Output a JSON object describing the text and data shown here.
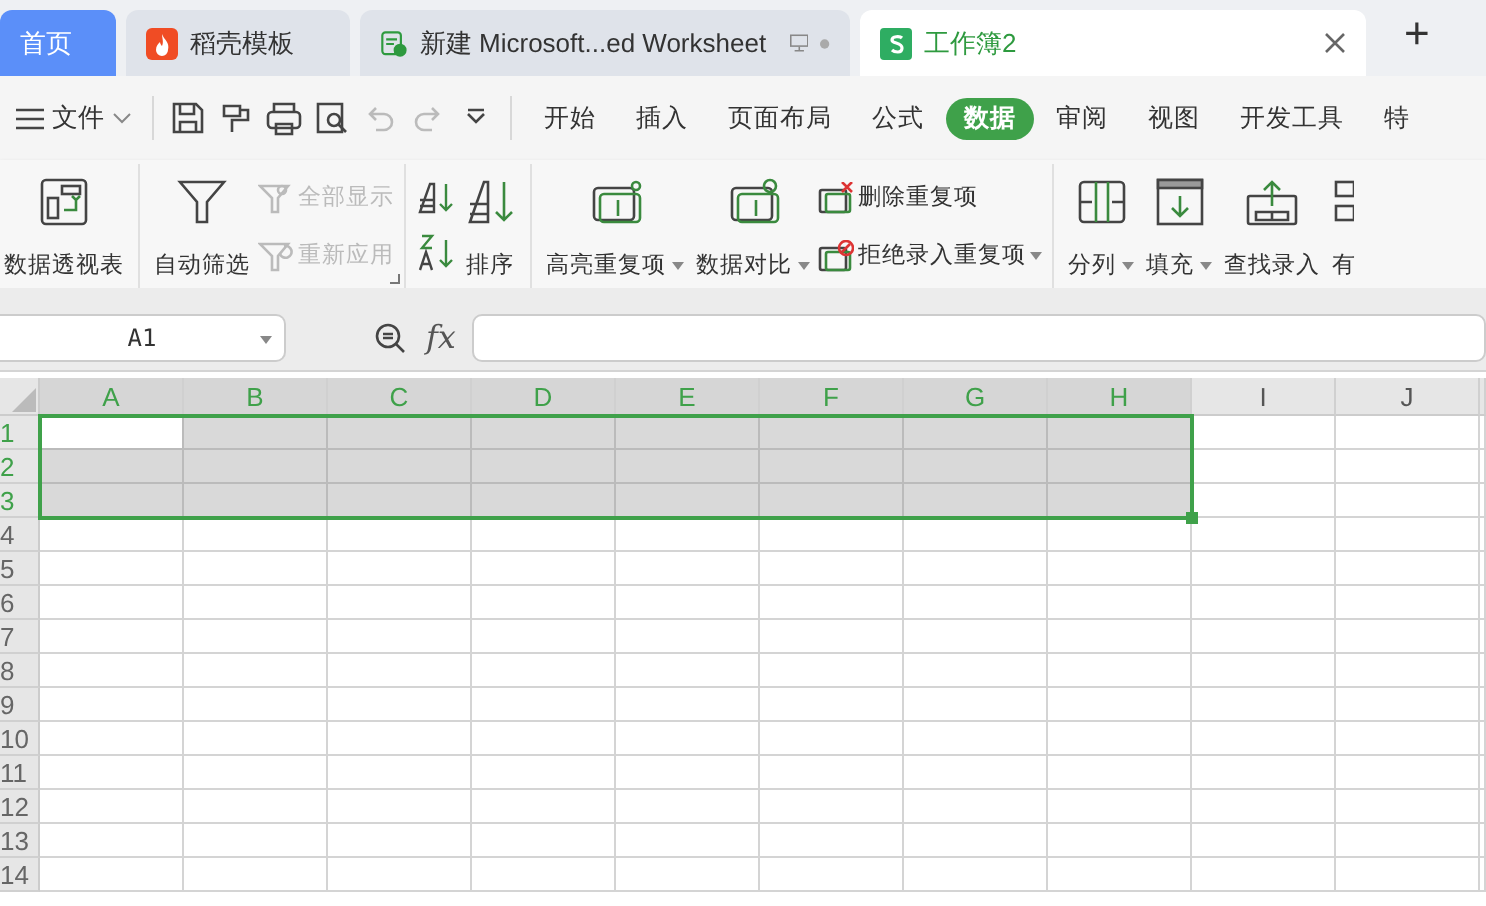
{
  "tabs": [
    {
      "kind": "home",
      "label": "首页",
      "selected": false
    },
    {
      "kind": "docer",
      "label": "稻壳模板",
      "selected": false
    },
    {
      "kind": "doc",
      "label": "新建 Microsoft...ed Worksheet",
      "selected": false
    },
    {
      "kind": "sheet",
      "label": "工作簿2",
      "selected": true
    }
  ],
  "new_tab": "+",
  "file_menu": "文件",
  "quick_tools": [
    {
      "kind": "save",
      "disabled": false
    },
    {
      "kind": "painter",
      "disabled": false
    },
    {
      "kind": "print",
      "disabled": false
    },
    {
      "kind": "preview",
      "disabled": false
    },
    {
      "kind": "undo",
      "disabled": true
    },
    {
      "kind": "redo",
      "disabled": true
    },
    {
      "kind": "more",
      "disabled": false
    }
  ],
  "ribbon_tabs": [
    {
      "label": "开始",
      "selected": false
    },
    {
      "label": "插入",
      "selected": false
    },
    {
      "label": "页面布局",
      "selected": false
    },
    {
      "label": "公式",
      "selected": false
    },
    {
      "label": "数据",
      "selected": true
    },
    {
      "label": "审阅",
      "selected": false
    },
    {
      "label": "视图",
      "selected": false
    },
    {
      "label": "开发工具",
      "selected": false
    },
    {
      "label": "特",
      "selected": false
    }
  ],
  "ribbon_groups": [
    {
      "items": [
        {
          "kind": "large",
          "label": "数据透视表",
          "dropdown": false,
          "disabled": false
        }
      ]
    },
    {
      "items": [
        {
          "kind": "large",
          "label": "自动筛选",
          "dropdown": false,
          "disabled": false
        },
        {
          "kind": "small",
          "label": "全部显示",
          "dropdown": false,
          "disabled": true
        },
        {
          "kind": "small",
          "label": "重新应用",
          "dropdown": false,
          "disabled": true
        }
      ],
      "launcher": true
    },
    {
      "items": [
        {
          "kind": "sortpair"
        },
        {
          "kind": "large",
          "label": "排序",
          "dropdown": false,
          "disabled": false
        }
      ]
    },
    {
      "items": [
        {
          "kind": "large",
          "label": "高亮重复项",
          "dropdown": true,
          "disabled": false
        },
        {
          "kind": "large",
          "label": "数据对比",
          "dropdown": true,
          "disabled": false
        },
        {
          "kind": "small",
          "label": "删除重复项",
          "dropdown": false,
          "disabled": false
        },
        {
          "kind": "small",
          "label": "拒绝录入重复项",
          "dropdown": true,
          "disabled": false
        }
      ]
    },
    {
      "items": [
        {
          "kind": "large",
          "label": "分列",
          "dropdown": true,
          "disabled": false
        },
        {
          "kind": "large",
          "label": "填充",
          "dropdown": true,
          "disabled": false
        },
        {
          "kind": "large",
          "label": "查找录入",
          "dropdown": false,
          "disabled": false
        },
        {
          "kind": "large",
          "label": "有",
          "dropdown": false,
          "disabled": false
        }
      ]
    }
  ],
  "name_box": "A1",
  "formula_label": "fx",
  "columns": [
    {
      "label": "A",
      "selected": true,
      "active": true
    },
    {
      "label": "B",
      "selected": true,
      "active": false
    },
    {
      "label": "C",
      "selected": true,
      "active": false
    },
    {
      "label": "D",
      "selected": true,
      "active": false
    },
    {
      "label": "E",
      "selected": true,
      "active": false
    },
    {
      "label": "F",
      "selected": true,
      "active": false
    },
    {
      "label": "G",
      "selected": true,
      "active": false
    },
    {
      "label": "H",
      "selected": true,
      "active": false
    },
    {
      "label": "I",
      "selected": false,
      "active": false
    },
    {
      "label": "J",
      "selected": false,
      "active": false
    }
  ],
  "rows": [
    {
      "label": "1",
      "selected": true,
      "active": true
    },
    {
      "label": "2",
      "selected": true,
      "active": false
    },
    {
      "label": "3",
      "selected": true,
      "active": false
    },
    {
      "label": "4",
      "selected": false,
      "active": false
    },
    {
      "label": "5",
      "selected": false,
      "active": false
    },
    {
      "label": "6",
      "selected": false,
      "active": false
    },
    {
      "label": "7",
      "selected": false,
      "active": false
    },
    {
      "label": "8",
      "selected": false,
      "active": false
    },
    {
      "label": "9",
      "selected": false,
      "active": false
    },
    {
      "label": "10",
      "selected": false,
      "active": false
    },
    {
      "label": "11",
      "selected": false,
      "active": false
    },
    {
      "label": "12",
      "selected": false,
      "active": false
    },
    {
      "label": "13",
      "selected": false,
      "active": false
    },
    {
      "label": "14",
      "selected": false,
      "active": false
    }
  ]
}
